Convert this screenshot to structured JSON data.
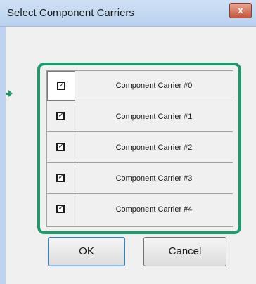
{
  "window": {
    "title": "Select Component Carriers",
    "close_label": "x"
  },
  "carriers": {
    "rows": [
      {
        "label": "Component Carrier #0",
        "checked": true,
        "check_glyph": "✓"
      },
      {
        "label": "Component Carrier #1",
        "checked": true,
        "check_glyph": "✓"
      },
      {
        "label": "Component Carrier #2",
        "checked": true,
        "check_glyph": "✓"
      },
      {
        "label": "Component Carrier #3",
        "checked": true,
        "check_glyph": "✓"
      },
      {
        "label": "Component Carrier #4",
        "checked": true,
        "check_glyph": "✓"
      }
    ]
  },
  "buttons": {
    "ok_label": "OK",
    "cancel_label": "Cancel"
  },
  "colors": {
    "highlight": "#1d9a6c",
    "titlebar": "#c4d8f1",
    "close_button": "#c8553c"
  }
}
